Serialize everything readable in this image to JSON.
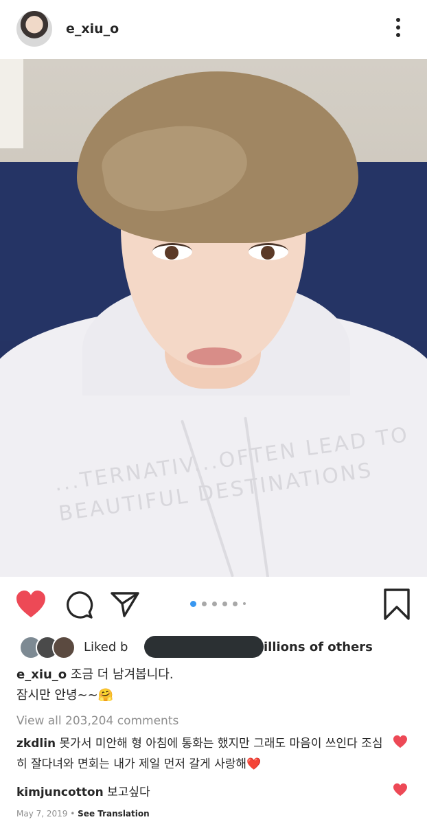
{
  "post": {
    "username": "e_xiu_o",
    "caption_line1": "조금 더 남겨봅니다.",
    "caption_line2": "잠시만 안녕~~🤗",
    "liked_prefix": "Liked b",
    "liked_suffix": "illions of others",
    "view_all": "View all 203,204 comments",
    "date": "May 7, 2019",
    "date_sep": " • ",
    "see_translation": "See Translation",
    "photo_print": "...TERNATIV...OFTEN LEAD TO BEAUTIFUL DESTINATIONS"
  },
  "carousel": {
    "current": 1,
    "dots_shown": 6
  },
  "comments": [
    {
      "username": "zkdlin",
      "text": "못가서 미안해 형 아침에 통화는 했지만 그래도 마음이 쓰인다 조심히 잘다녀와 면회는 내가 제일 먼저 갈게 사랑해❤️"
    },
    {
      "username": "kimjuncotton",
      "text": "보고싶다"
    }
  ],
  "icons": {
    "more": "more-vertical-icon",
    "like": "heart-filled-icon",
    "comment": "comment-icon",
    "share": "send-icon",
    "save": "bookmark-icon"
  },
  "colors": {
    "like": "#ed4956",
    "active_dot": "#3897f0",
    "muted": "#8e8e8e"
  }
}
